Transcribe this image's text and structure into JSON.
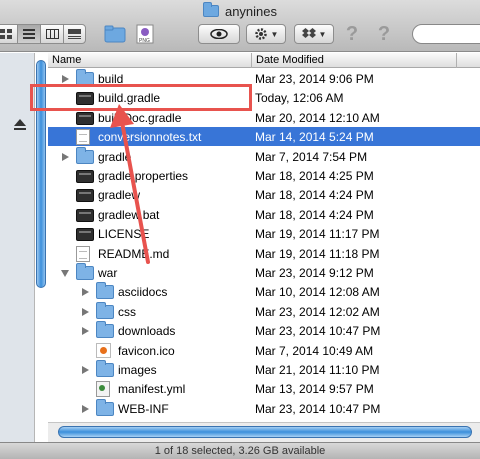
{
  "window": {
    "title": "anynines"
  },
  "toolbar": {
    "view_buttons": [
      "icon-view",
      "list-view",
      "column-view",
      "coverflow-view"
    ],
    "help_glyph": "?"
  },
  "header": {
    "name_col": "Name",
    "date_col": "Date Modified"
  },
  "rows": [
    {
      "name": "build",
      "date": "Mar 23, 2014 9:06 PM",
      "icon": "folder-icon",
      "triangle": "closed",
      "indent": 0,
      "selected": false
    },
    {
      "name": "build.gradle",
      "date": "Today, 12:06 AM",
      "icon": "executable-icon",
      "triangle": "none",
      "indent": 0,
      "selected": false
    },
    {
      "name": "buildDoc.gradle",
      "date": "Mar 20, 2014 12:10 AM",
      "icon": "executable-icon",
      "triangle": "none",
      "indent": 0,
      "selected": false
    },
    {
      "name": "conversionnotes.txt",
      "date": "Mar 14, 2014 5:24 PM",
      "icon": "document-icon",
      "triangle": "none",
      "indent": 0,
      "selected": true
    },
    {
      "name": "gradle",
      "date": "Mar 7, 2014 7:54 PM",
      "icon": "folder-icon",
      "triangle": "closed",
      "indent": 0,
      "selected": false
    },
    {
      "name": "gradle.properties",
      "date": "Mar 18, 2014 4:25 PM",
      "icon": "executable-icon",
      "triangle": "none",
      "indent": 0,
      "selected": false
    },
    {
      "name": "gradlew",
      "date": "Mar 18, 2014 4:24 PM",
      "icon": "executable-icon",
      "triangle": "none",
      "indent": 0,
      "selected": false
    },
    {
      "name": "gradlew.bat",
      "date": "Mar 18, 2014 4:24 PM",
      "icon": "executable-icon",
      "triangle": "none",
      "indent": 0,
      "selected": false
    },
    {
      "name": "LICENSE",
      "date": "Mar 19, 2014 11:17 PM",
      "icon": "executable-icon",
      "triangle": "none",
      "indent": 0,
      "selected": false
    },
    {
      "name": "README.md",
      "date": "Mar 19, 2014 11:18 PM",
      "icon": "document-icon",
      "triangle": "none",
      "indent": 0,
      "selected": false
    },
    {
      "name": "war",
      "date": "Mar 23, 2014 9:12 PM",
      "icon": "folder-icon",
      "triangle": "open",
      "indent": 0,
      "selected": false
    },
    {
      "name": "asciidocs",
      "date": "Mar 10, 2014 12:08 AM",
      "icon": "folder-icon",
      "triangle": "closed",
      "indent": 1,
      "selected": false
    },
    {
      "name": "css",
      "date": "Mar 23, 2014 12:02 AM",
      "icon": "folder-icon",
      "triangle": "closed",
      "indent": 1,
      "selected": false
    },
    {
      "name": "downloads",
      "date": "Mar 23, 2014 10:47 PM",
      "icon": "folder-icon",
      "triangle": "closed",
      "indent": 1,
      "selected": false
    },
    {
      "name": "favicon.ico",
      "date": "Mar 7, 2014 10:49 AM",
      "icon": "ico-file-icon",
      "triangle": "none",
      "indent": 1,
      "selected": false
    },
    {
      "name": "images",
      "date": "Mar 21, 2014 11:10 PM",
      "icon": "folder-icon",
      "triangle": "closed",
      "indent": 1,
      "selected": false
    },
    {
      "name": "manifest.yml",
      "date": "Mar 13, 2014 9:57 PM",
      "icon": "yml-file-icon",
      "triangle": "none",
      "indent": 1,
      "selected": false
    },
    {
      "name": "WEB-INF",
      "date": "Mar 23, 2014 10:47 PM",
      "icon": "folder-icon",
      "triangle": "closed",
      "indent": 1,
      "selected": false
    }
  ],
  "status": {
    "text": "1 of 18 selected, 3.26 GB available"
  },
  "colors": {
    "selection": "#3875d7",
    "annotation": "#e8534e"
  }
}
